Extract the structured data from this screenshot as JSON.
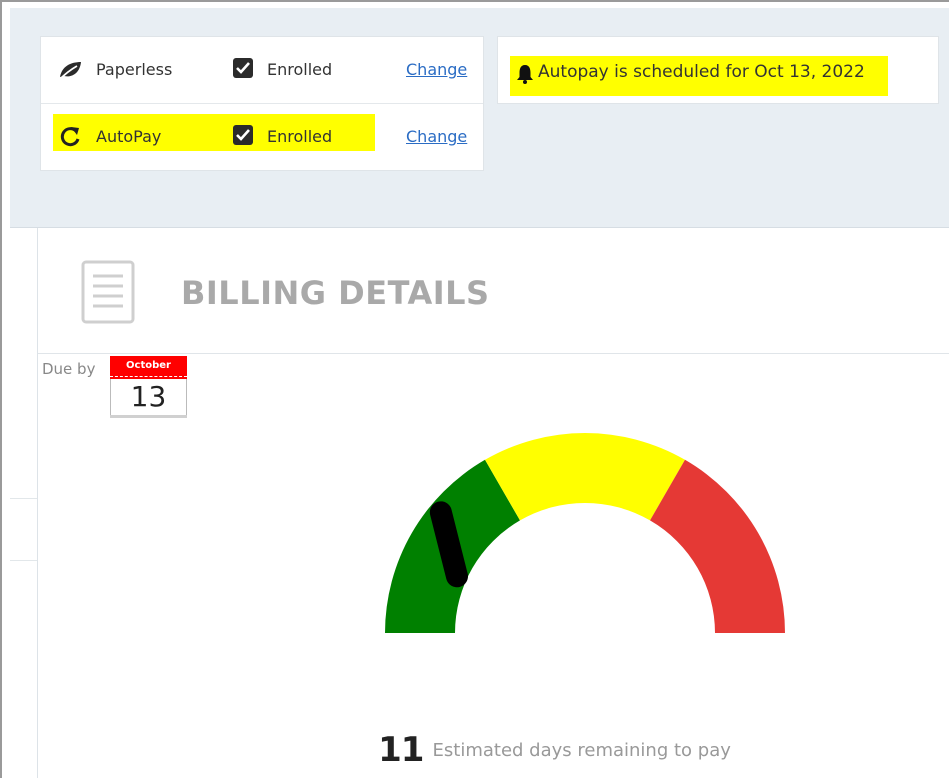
{
  "enrollment": {
    "rows": [
      {
        "label": "Paperless",
        "status": "Enrolled",
        "action": "Change",
        "icon": "leaf-icon",
        "highlighted": false
      },
      {
        "label": "AutoPay",
        "status": "Enrolled",
        "action": "Change",
        "icon": "refresh-icon",
        "highlighted": true
      }
    ]
  },
  "notice": {
    "text": "Autopay is scheduled for Oct 13, 2022",
    "icon": "bell-icon"
  },
  "billing": {
    "title": "BILLING DETAILS",
    "icon": "document-icon"
  },
  "due": {
    "label": "Due by",
    "month": "October",
    "day": "13"
  },
  "gauge": {
    "segments": [
      {
        "name": "green",
        "color": "#008000"
      },
      {
        "name": "yellow",
        "color": "#ffff00"
      },
      {
        "name": "red",
        "color": "#e53935"
      }
    ],
    "needle_level": 0.12
  },
  "days_remaining": {
    "value": "11",
    "label": "Estimated days remaining to pay"
  },
  "colors": {
    "highlight": "#ffff00",
    "link": "#2a6cc4",
    "calendar_red": "#ff0000"
  }
}
